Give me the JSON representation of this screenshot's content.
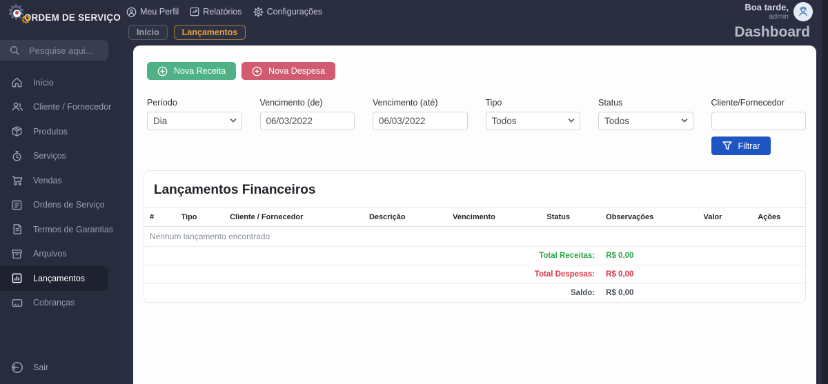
{
  "app": {
    "title": "ORDEM DE SERVIÇO",
    "logo_icon": "gears-logo-icon"
  },
  "topbar": {
    "menu": [
      {
        "label": "Meu Perfil",
        "icon": "person-circle-icon"
      },
      {
        "label": "Relatórios",
        "icon": "report-icon"
      },
      {
        "label": "Configurações",
        "icon": "gear-icon"
      }
    ],
    "greeting": "Boa tarde,",
    "username": "admin",
    "avatar_icon": "admin-headset-icon"
  },
  "sidebar": {
    "search_placeholder": "Pesquise aqui...",
    "search_icon": "search-icon",
    "items": [
      {
        "label": "Início",
        "icon": "home-icon",
        "active": false
      },
      {
        "label": "Cliente / Fornecedor",
        "icon": "people-icon",
        "active": false
      },
      {
        "label": "Produtos",
        "icon": "package-icon",
        "active": false
      },
      {
        "label": "Serviços",
        "icon": "stopwatch-icon",
        "active": false
      },
      {
        "label": "Vendas",
        "icon": "cart-icon",
        "active": false
      },
      {
        "label": "Ordens de Serviço",
        "icon": "order-list-icon",
        "active": false
      },
      {
        "label": "Termos de Garantias",
        "icon": "warranty-doc-icon",
        "active": false
      },
      {
        "label": "Arquivos",
        "icon": "archive-icon",
        "active": false
      },
      {
        "label": "Lançamentos",
        "icon": "bar-chart-icon",
        "active": true
      },
      {
        "label": "Cobranças",
        "icon": "billing-card-icon",
        "active": false
      }
    ],
    "logout": {
      "label": "Sair",
      "icon": "logout-icon"
    }
  },
  "tabs": [
    {
      "label": "Início",
      "active": false
    },
    {
      "label": "Lançamentos",
      "active": true
    }
  ],
  "page_title": "Dashboard",
  "actions": {
    "new_income_label": "Nova Receita",
    "new_income_icon": "plus-circle-icon",
    "new_expense_label": "Nova Despesa",
    "new_expense_icon": "plus-circle-icon"
  },
  "filters": {
    "periodo": {
      "label": "Período",
      "value": "Dia"
    },
    "vencimento_de": {
      "label": "Vencimento (de)",
      "value": "06/03/2022"
    },
    "vencimento_ate": {
      "label": "Vencimento (até)",
      "value": "06/03/2022"
    },
    "tipo": {
      "label": "Tipo",
      "value": "Todos"
    },
    "status": {
      "label": "Status",
      "value": "Todos"
    },
    "cliente_fornecedor": {
      "label": "Cliente/Fornecedor",
      "value": ""
    },
    "filter_button": {
      "label": "Filtrar",
      "icon": "funnel-icon"
    }
  },
  "table": {
    "title": "Lançamentos Financeiros",
    "columns": [
      "#",
      "Tipo",
      "Cliente / Fornecedor",
      "Descrição",
      "Vencimento",
      "Status",
      "Observações",
      "Valor",
      "Ações"
    ],
    "empty_message": "Nenhum lançamento encontrado",
    "totals": [
      {
        "label": "Total Receitas:",
        "value": "R$ 0,00",
        "color": "#28a745"
      },
      {
        "label": "Total Despesas:",
        "value": "R$ 0,00",
        "color": "#dc3545"
      },
      {
        "label": "Saldo:",
        "value": "R$ 0,00",
        "color": "#495057"
      }
    ]
  },
  "colors": {
    "sidebar_bg": "#292c3d",
    "content_bg": "#2b2e40",
    "active_item_bg": "#1d2130",
    "accent_orange": "#e3a23c",
    "income_green": "#4fb286",
    "expense_red": "#d15b70",
    "filter_blue": "#1d56c2",
    "success_text": "#28a745",
    "danger_text": "#dc3545"
  }
}
